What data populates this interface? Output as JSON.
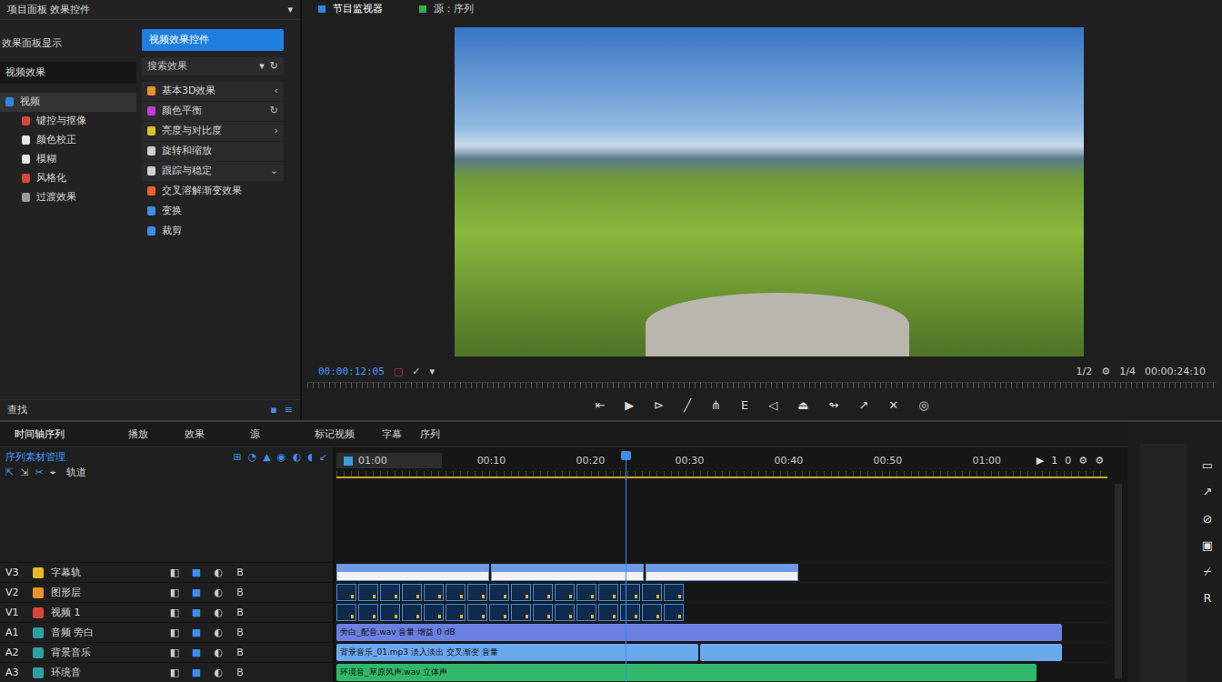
{
  "project_panel": {
    "title": "项目面板 效果控件",
    "menu": "▾",
    "left_header": "效果面板显示",
    "left_field": "视频效果",
    "categories": [
      {
        "label": "视频",
        "selected": true,
        "child": false,
        "color": "#2f86e6"
      },
      {
        "label": "键控与抠像",
        "selected": false,
        "child": true,
        "color": "#d9453a"
      },
      {
        "label": "颜色校正",
        "selected": false,
        "child": true,
        "color": "#e6e6e6"
      },
      {
        "label": "模糊",
        "selected": false,
        "child": true,
        "color": "#e6e6e6"
      },
      {
        "label": "风格化",
        "selected": false,
        "child": true,
        "color": "#d9453a"
      },
      {
        "label": "过渡效果",
        "selected": false,
        "child": true,
        "color": "#9a9a9a"
      }
    ],
    "effects_header": "视频效果控件",
    "search": {
      "placeholder": "搜索效果",
      "icons": [
        "▾",
        "↻"
      ]
    },
    "effects": [
      {
        "label": "基本3D效果",
        "tail": "‹",
        "boxed": true,
        "color": "#e8932a"
      },
      {
        "label": "颜色平衡",
        "tail": "↻",
        "boxed": true,
        "color": "#c23bd4"
      },
      {
        "label": "亮度与对比度",
        "tail": "›",
        "boxed": true,
        "color": "#d8c42a"
      },
      {
        "label": "旋转和缩放",
        "tail": "",
        "boxed": true,
        "color": "#cfcfcf"
      },
      {
        "label": "跟踪与稳定",
        "tail": "⌄",
        "boxed": true,
        "color": "#cfcfcf"
      },
      {
        "label": "交叉溶解渐变效果",
        "tail": "",
        "boxed": false,
        "color": "#e8622a"
      },
      {
        "label": "变换",
        "tail": "",
        "boxed": false,
        "color": "#3a8ee6"
      },
      {
        "label": "裁剪",
        "tail": "",
        "boxed": false,
        "color": "#3a8ee6"
      }
    ],
    "footer": {
      "label": "查找",
      "icons": [
        "▪",
        "≡"
      ]
    }
  },
  "monitor": {
    "tabs": [
      {
        "label": "节目监视器",
        "selected": true
      },
      {
        "label": "源：序列",
        "selected": false
      }
    ],
    "timecode": "00:00:12:05",
    "timecode_icons": [
      "▢",
      "✓",
      "▾"
    ],
    "right": [
      "1/2",
      "⚙",
      "1/4",
      "00:00:24:10"
    ],
    "controls": [
      "⇤",
      "▶",
      "⊳",
      "╱",
      "⋔",
      "E",
      "◁",
      "⏏",
      "↬",
      "↗",
      "✕",
      "◎"
    ]
  },
  "timeline": {
    "tabs": [
      {
        "label": "时间轴序列",
        "selected": true
      },
      {
        "label": "播放",
        "selected": false
      },
      {
        "label": "效果",
        "selected": false
      },
      {
        "label": "源",
        "selected": false
      },
      {
        "label": "标记视频",
        "selected": false
      },
      {
        "label": "字幕",
        "selected": false
      },
      {
        "label": "序列",
        "selected": false
      }
    ],
    "sequence_title": "序列素材管理",
    "head_icons": [
      "⊞",
      "◔",
      "▲",
      "◉",
      "◐",
      "◖",
      "↙"
    ],
    "tool_icons": [
      "⇱",
      "⇲",
      "✂",
      "⌖"
    ],
    "tool_field": "轨道",
    "chip": "01:00",
    "ruler": [
      "00:10",
      "00:20",
      "00:30",
      "00:40",
      "00:50",
      "01:00"
    ],
    "ruler_controls": [
      "▶",
      "1",
      "0",
      "⚙",
      "⚙"
    ],
    "track_controls": [
      "◧",
      "■",
      "◐",
      "B"
    ],
    "tracks": [
      {
        "id": "V3",
        "name": "字幕轨",
        "kind": "title",
        "color": "#e8b72a",
        "clips": [
          {
            "label": "",
            "color": "#6f9be6"
          },
          {
            "label": "",
            "color": "#6f9be6"
          },
          {
            "label": "",
            "color": "#6f9be6"
          }
        ]
      },
      {
        "id": "V2",
        "name": "图形层",
        "kind": "boxes",
        "color": "#e8932a",
        "clips": [
          {
            "label": "",
            "color": "#3a8ee6"
          },
          {
            "label": "",
            "color": "#3a8ee6"
          },
          {
            "label": "",
            "color": "#3a8ee6"
          },
          {
            "label": "",
            "color": "#3a8ee6"
          },
          {
            "label": "",
            "color": "#3a8ee6"
          },
          {
            "label": "",
            "color": "#3a8ee6"
          },
          {
            "label": "",
            "color": "#3a8ee6"
          },
          {
            "label": "",
            "color": "#3a8ee6"
          },
          {
            "label": "",
            "color": "#3a8ee6"
          },
          {
            "label": "",
            "color": "#3a8ee6"
          },
          {
            "label": "",
            "color": "#3a8ee6"
          },
          {
            "label": "",
            "color": "#3a8ee6"
          },
          {
            "label": "",
            "color": "#3a8ee6"
          },
          {
            "label": "",
            "color": "#3a8ee6"
          },
          {
            "label": "",
            "color": "#3a8ee6"
          },
          {
            "label": "",
            "color": "#3a8ee6"
          }
        ]
      },
      {
        "id": "V1",
        "name": "视频 1",
        "kind": "boxes",
        "color": "#d9453a",
        "clips": []
      },
      {
        "id": "A1",
        "name": "音频 旁白",
        "kind": "audio",
        "color": "#2fa0a0",
        "clips": [
          {
            "label": "旁白_配音.wav  音量 增益 0 dB",
            "color": "#6a7fe0"
          }
        ]
      },
      {
        "id": "A2",
        "name": "背景音乐",
        "kind": "audio",
        "color": "#2fa0a0",
        "clips": [
          {
            "label": "背景音乐_01.mp3  淡入淡出  交叉渐变  音量",
            "color": "#6aa8ee"
          },
          {
            "label": "",
            "color": "#6aa8ee"
          }
        ]
      },
      {
        "id": "A3",
        "name": "环境音",
        "kind": "audio2",
        "color": "#2fa0a0",
        "clips": [
          {
            "label": "环境音_草原风声.wav  立体声",
            "color": "#2fb86a"
          }
        ]
      }
    ]
  },
  "side_tools": [
    "▭",
    "↗",
    "⊘",
    "▣",
    "⌿",
    "R"
  ]
}
